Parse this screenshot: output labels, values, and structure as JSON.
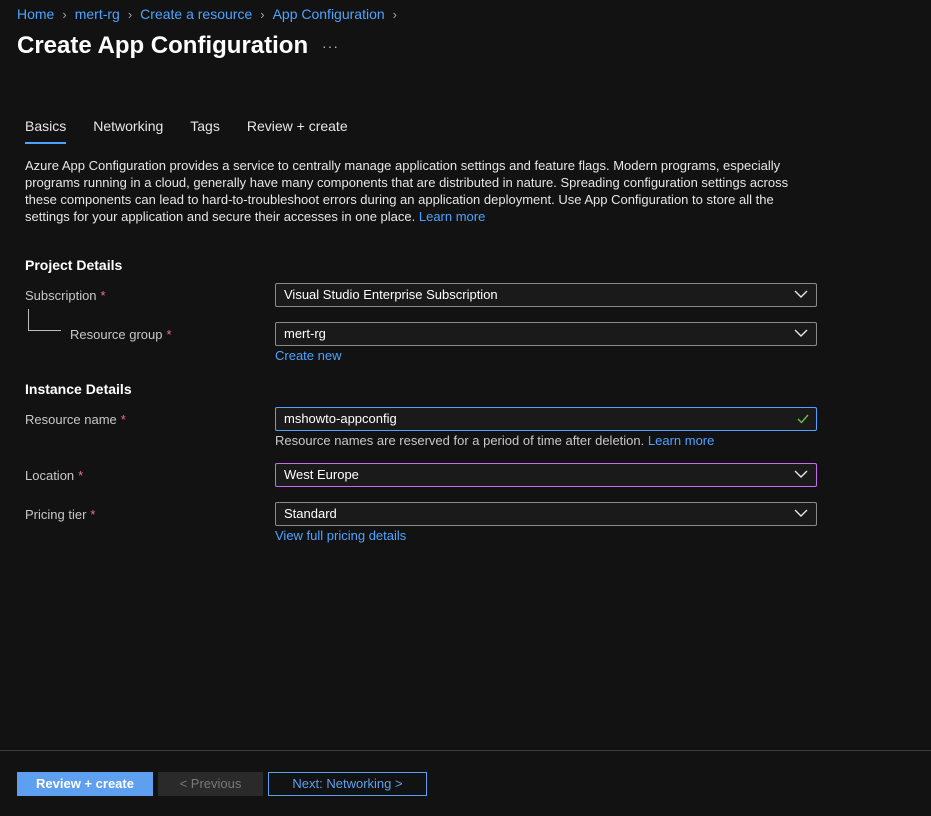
{
  "breadcrumb": [
    "Home",
    "mert-rg",
    "Create a resource",
    "App Configuration"
  ],
  "title": "Create App Configuration",
  "more_label": "···",
  "tabs": [
    {
      "label": "Basics"
    },
    {
      "label": "Networking"
    },
    {
      "label": "Tags"
    },
    {
      "label": "Review + create"
    }
  ],
  "description": {
    "text": "Azure App Configuration provides a service to centrally manage application settings and feature flags. Modern programs, especially programs running in a cloud, generally have many components that are distributed in nature. Spreading configuration settings across these components can lead to hard-to-troubleshoot errors during an application deployment. Use App Configuration to store all the settings for your application and secure their accesses in one place.",
    "learn_more": "Learn more"
  },
  "project": {
    "heading": "Project Details",
    "subscription_label": "Subscription",
    "subscription_value": "Visual Studio Enterprise Subscription",
    "resource_group_label": "Resource group",
    "resource_group_value": "mert-rg",
    "create_new": "Create new"
  },
  "instance": {
    "heading": "Instance Details",
    "resource_name_label": "Resource name",
    "resource_name_value": "mshowto-appconfig",
    "resource_name_hint": "Resource names are reserved for a period of time after deletion.",
    "resource_name_learn_more": "Learn more",
    "location_label": "Location",
    "location_value": "West Europe",
    "pricing_label": "Pricing tier",
    "pricing_value": "Standard",
    "pricing_link": "View full pricing details"
  },
  "required_mark": "*",
  "footer": {
    "review_create": "Review + create",
    "previous": "< Previous",
    "next": "Next: Networking >"
  },
  "colors": {
    "accent": "#4da3ff",
    "required": "#f1707b",
    "location_border": "#c56cf0",
    "valid_check": "#6cc04a"
  }
}
